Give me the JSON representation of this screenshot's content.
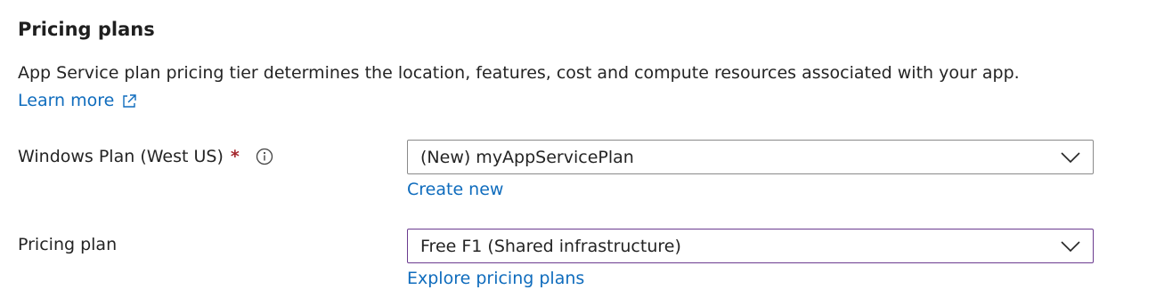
{
  "section": {
    "title": "Pricing plans",
    "description": "App Service plan pricing tier determines the location, features, cost and compute resources associated with your app.",
    "learn_more": "Learn more"
  },
  "fields": {
    "windows_plan": {
      "label": "Windows Plan (West US)",
      "required_marker": "*",
      "value": "(New) myAppServicePlan",
      "action_link": "Create new"
    },
    "pricing_plan": {
      "label": "Pricing plan",
      "value": "Free F1 (Shared infrastructure)",
      "action_link": "Explore pricing plans"
    }
  },
  "icons": {
    "external_link": "external-link-icon",
    "info": "info-icon",
    "chevron": "chevron-down-icon"
  },
  "colors": {
    "link": "#0f6cbd",
    "required": "#a4262c",
    "focused_border": "#6b3b8f",
    "border": "#8a8a8a",
    "text": "#242424"
  }
}
